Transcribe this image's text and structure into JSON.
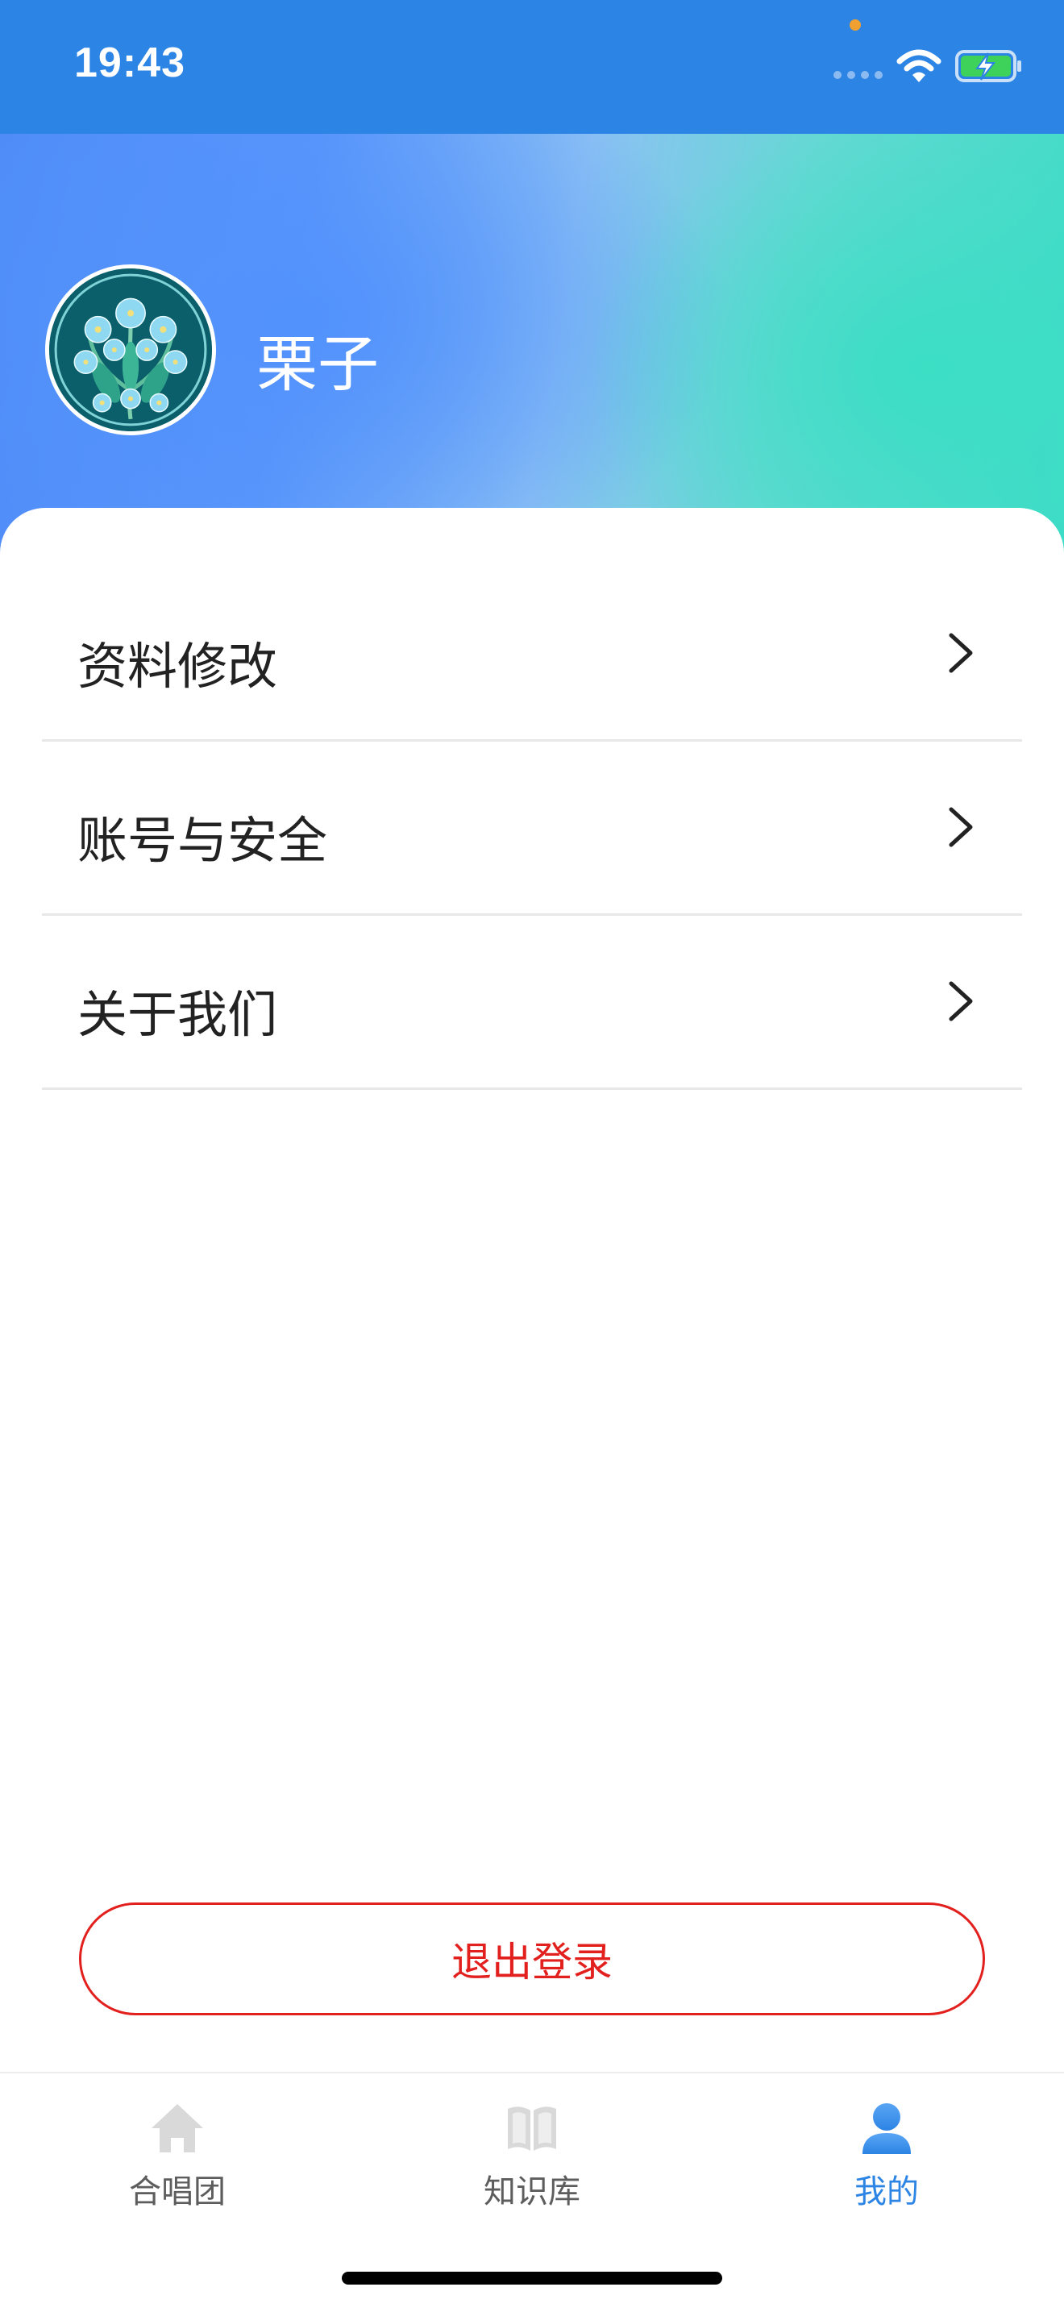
{
  "status_bar": {
    "time": "19:43",
    "icons": [
      "signal-dots-icon",
      "wifi-icon",
      "battery-charging-icon"
    ],
    "privacy_dot_color": "#f0a030"
  },
  "profile": {
    "username": "栗子",
    "avatar": "floral-avatar-image"
  },
  "menu": {
    "items": [
      {
        "label": "资料修改",
        "icon": "chevron-right-icon"
      },
      {
        "label": "账号与安全",
        "icon": "chevron-right-icon"
      },
      {
        "label": "关于我们",
        "icon": "chevron-right-icon"
      }
    ]
  },
  "logout": {
    "label": "退出登录",
    "color": "#e2201e"
  },
  "tab_bar": {
    "tabs": [
      {
        "label": "合唱团",
        "icon": "home-icon",
        "active": false
      },
      {
        "label": "知识库",
        "icon": "book-icon",
        "active": false
      },
      {
        "label": "我的",
        "icon": "user-icon",
        "active": true
      }
    ]
  },
  "colors": {
    "status_bar_bg": "#2c84e4",
    "header_gradient_start": "#4f8cf8",
    "header_gradient_end": "#3ddcc6",
    "active_tab": "#2c84e4",
    "inactive_tab_icon": "#d9d9d9"
  }
}
